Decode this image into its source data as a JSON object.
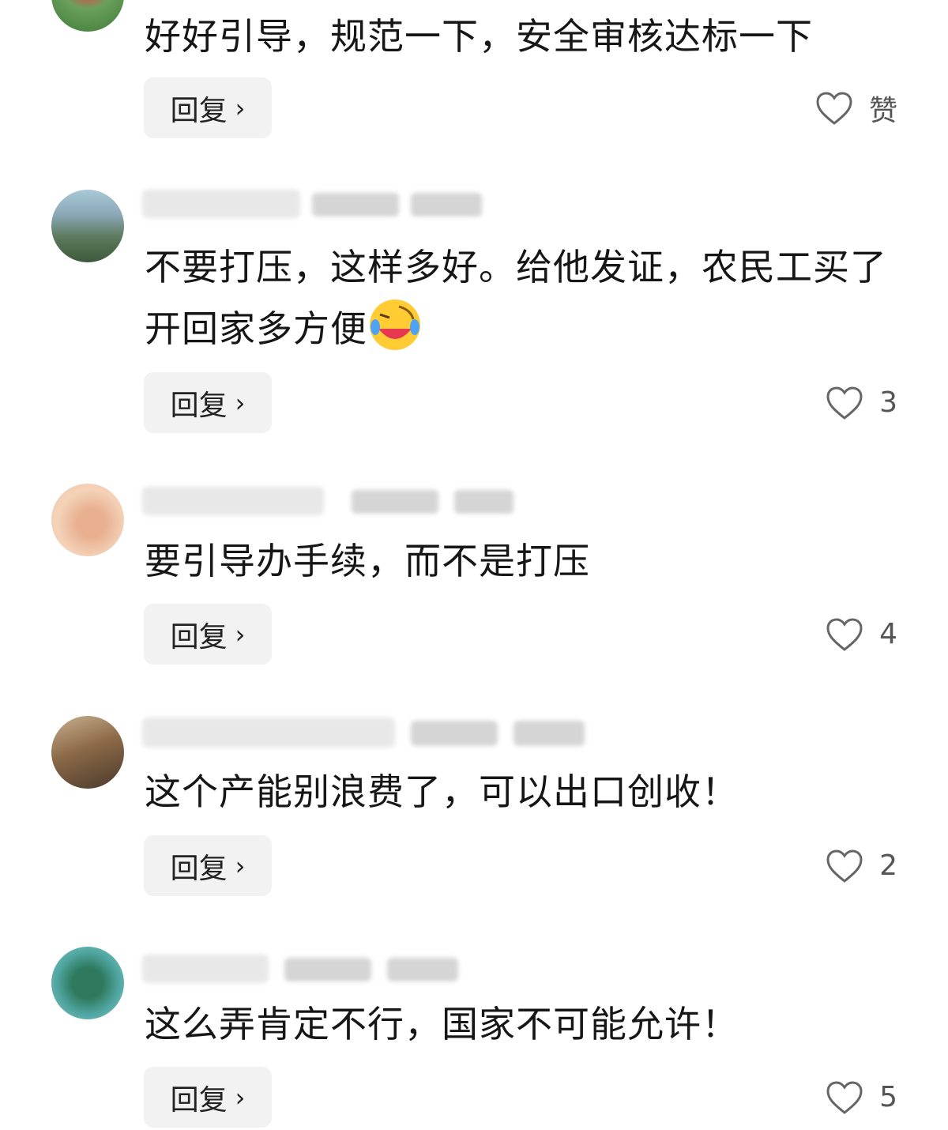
{
  "comments": [
    {
      "text": "好好引导，规范一下，安全审核达标一下",
      "reply_label": "回复",
      "likes": "赞"
    },
    {
      "text": "不要打压，这样多好。给他发证，农民工买了开回家多方便",
      "reply_label": "回复",
      "likes": "3"
    },
    {
      "text": "要引导办手续，而不是打压",
      "reply_label": "回复",
      "likes": "4"
    },
    {
      "text": "这个产能别浪费了，可以出口创收！",
      "reply_label": "回复",
      "likes": "2"
    },
    {
      "text": "这么弄肯定不行，国家不可能允许！",
      "reply_label": "回复",
      "likes": "5"
    }
  ],
  "icons": {
    "reply_chevron": "chevron-right-icon",
    "like": "heart-outline-icon",
    "emoji": "laughing-tears-emoji"
  }
}
